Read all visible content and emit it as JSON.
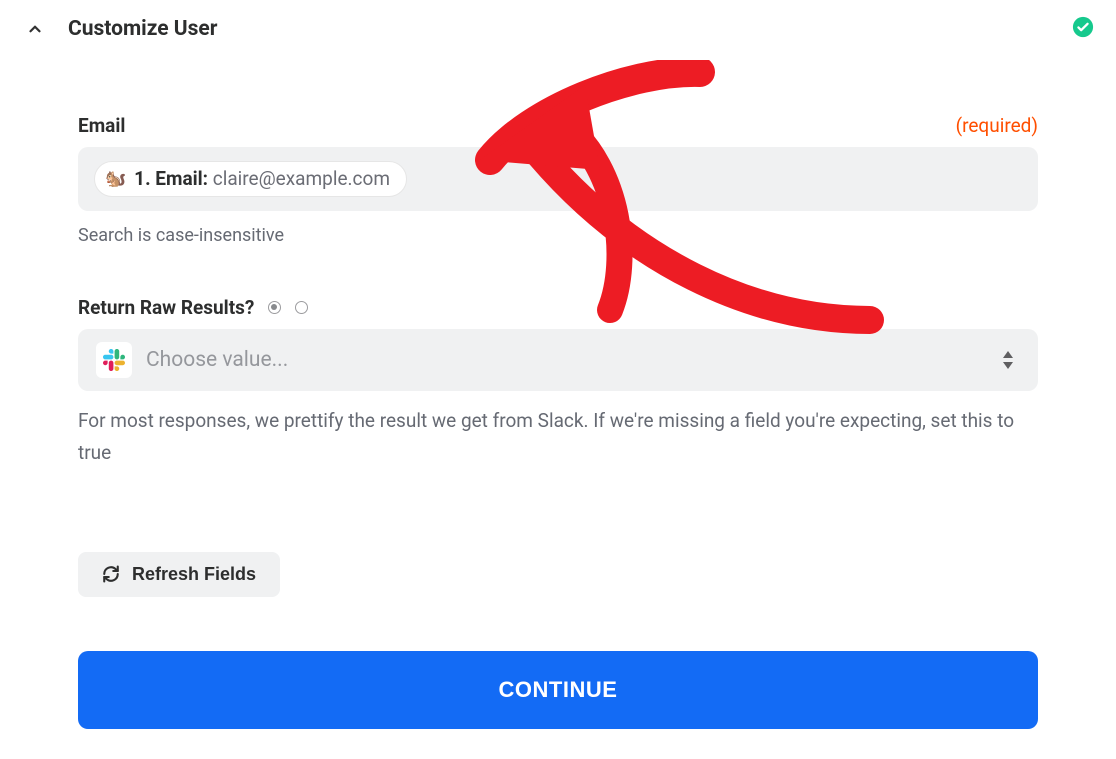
{
  "header": {
    "title": "Customize User"
  },
  "fields": {
    "email": {
      "label": "Email",
      "required_tag": "(required)",
      "pill_prefix": "1. Email:",
      "pill_value": "claire@example.com",
      "help": "Search is case-insensitive"
    },
    "raw": {
      "label": "Return Raw Results?",
      "placeholder": "Choose value...",
      "help": "For most responses, we prettify the result we get from Slack. If we're missing a field you're expecting, set this to true"
    }
  },
  "buttons": {
    "refresh": "Refresh Fields",
    "continue": "CONTINUE"
  },
  "icons": {
    "pill_emoji": "🐿️"
  }
}
